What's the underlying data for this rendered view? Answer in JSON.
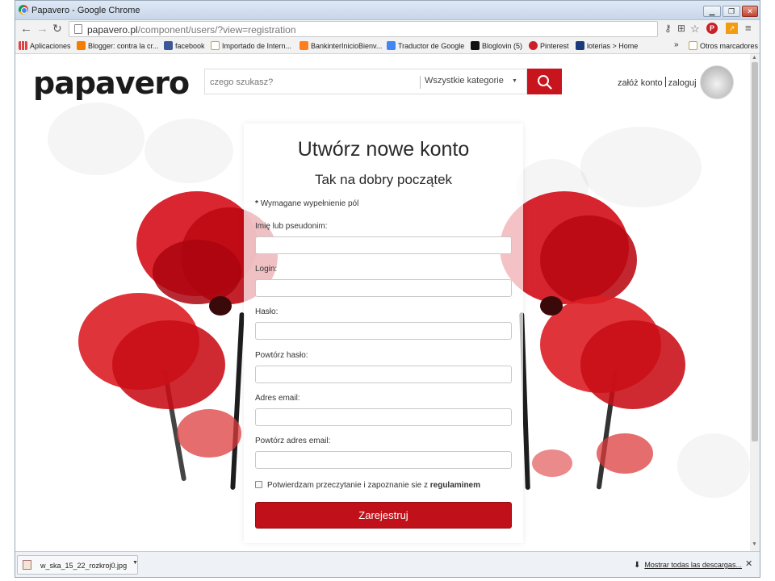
{
  "browser": {
    "window_title": "Papavero - Google Chrome",
    "url_host": "papavero.pl",
    "url_path": "/component/users/?view=registration",
    "bookmarks": [
      {
        "label": "Aplicaciones",
        "icon": "apps-grid-icon",
        "color": "#5b5b5b"
      },
      {
        "label": "Blogger: contra la cr...",
        "icon": "blogger-icon",
        "color": "#f57d00"
      },
      {
        "label": "facebook",
        "icon": "facebook-icon",
        "color": "#3b5998"
      },
      {
        "label": "Importado de Intern...",
        "icon": "folder-icon",
        "color": "#e5c164"
      },
      {
        "label": "BankinterInicioBienv...",
        "icon": "bankinter-icon",
        "color": "#ff7f1f"
      },
      {
        "label": "Traductor de Google",
        "icon": "google-translate-icon",
        "color": "#4285f4"
      },
      {
        "label": "Bloglovin (5)",
        "icon": "bloglovin-icon",
        "color": "#111111"
      },
      {
        "label": "Pinterest",
        "icon": "pinterest-icon",
        "color": "#cb2027"
      },
      {
        "label": "loterias > Home",
        "icon": "loterias-icon",
        "color": "#1a3a7a"
      }
    ],
    "bookmarks_overflow": "»",
    "other_bookmarks": "Otros marcadores"
  },
  "site": {
    "logo_text": "papavero",
    "search_placeholder": "czego szukasz?",
    "category_select": "Wszystkie kategorie",
    "link_register": "załóż konto",
    "link_login": "zaloguj",
    "accent_color": "#c8141d"
  },
  "form": {
    "title": "Utwórz nowe konto",
    "subtitle": "Tak na dobry początek",
    "required_star": "*",
    "required_note": "Wymagane wypełnienie pól",
    "fields": [
      {
        "label": "Imię lub pseudonim:",
        "value": ""
      },
      {
        "label": "Login:",
        "value": ""
      },
      {
        "label": "Hasło:",
        "value": ""
      },
      {
        "label": "Powtórz hasło:",
        "value": ""
      },
      {
        "label": "Adres email:",
        "value": ""
      },
      {
        "label": "Powtórz adres email:",
        "value": ""
      }
    ],
    "terms_text": "Potwierdzam przeczytanie i zapoznanie sie z ",
    "terms_link": "regulaminem",
    "terms_checked": false,
    "submit_label": "Zarejestruj"
  },
  "downloads": {
    "file_name": "w_ska_15_22_rozkroj0.jpg",
    "show_all": "Mostrar todas las descargas..."
  }
}
